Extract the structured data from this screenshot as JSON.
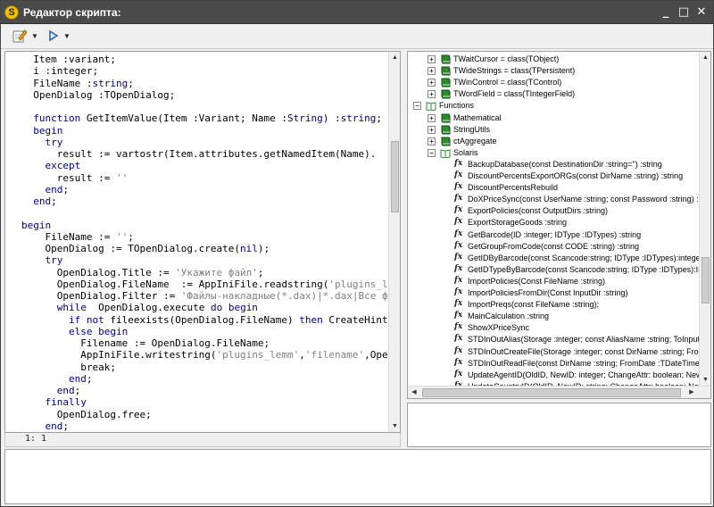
{
  "window": {
    "title": "Редактор скрипта:",
    "app_icon_letter": "S"
  },
  "titlebar_buttons": {
    "minimize": "_",
    "maximize": "□",
    "close": "✕"
  },
  "toolbar": {
    "edit_icon": "edit-icon",
    "run_icon": "run-icon"
  },
  "status": {
    "position": "1: 1"
  },
  "code": [
    [
      {
        "t": "  Item :variant;"
      }
    ],
    [
      {
        "t": "  i :integer;"
      }
    ],
    [
      {
        "t": "  FileName :"
      },
      {
        "t": "string",
        "c": "kw"
      },
      {
        "t": ";"
      }
    ],
    [
      {
        "t": "  OpenDialog :TOpenDialog;"
      }
    ],
    [
      {
        "t": ""
      }
    ],
    [
      {
        "t": "  "
      },
      {
        "t": "function",
        "c": "kw"
      },
      {
        "t": " GetItemValue(Item :Variant; Name :"
      },
      {
        "t": "String",
        "c": "kw"
      },
      {
        "t": ") :"
      },
      {
        "t": "string",
        "c": "kw"
      },
      {
        "t": ";"
      }
    ],
    [
      {
        "t": "  "
      },
      {
        "t": "begin",
        "c": "kw"
      }
    ],
    [
      {
        "t": "    "
      },
      {
        "t": "try",
        "c": "kw"
      }
    ],
    [
      {
        "t": "      result := vartostr(Item.attributes.getNamedItem(Name)."
      }
    ],
    [
      {
        "t": "    "
      },
      {
        "t": "except",
        "c": "kw"
      }
    ],
    [
      {
        "t": "      result := "
      },
      {
        "t": "''",
        "c": "str"
      }
    ],
    [
      {
        "t": "    "
      },
      {
        "t": "end",
        "c": "kw"
      },
      {
        "t": ";"
      }
    ],
    [
      {
        "t": "  "
      },
      {
        "t": "end",
        "c": "kw"
      },
      {
        "t": ";"
      }
    ],
    [
      {
        "t": ""
      }
    ],
    [
      {
        "t": "begin",
        "c": "kw"
      }
    ],
    [
      {
        "t": "    FileName := "
      },
      {
        "t": "''",
        "c": "str"
      },
      {
        "t": ";"
      }
    ],
    [
      {
        "t": "    OpenDialog := TOpenDialog.create("
      },
      {
        "t": "nil",
        "c": "kw"
      },
      {
        "t": ");"
      }
    ],
    [
      {
        "t": "    "
      },
      {
        "t": "try",
        "c": "kw"
      }
    ],
    [
      {
        "t": "      OpenDialog.Title := "
      },
      {
        "t": "'Укажите файл'",
        "c": "str"
      },
      {
        "t": ";"
      }
    ],
    [
      {
        "t": "      OpenDialog.FileName  := AppIniFile.readstring("
      },
      {
        "t": "'plugins_l",
        "c": "str"
      }
    ],
    [
      {
        "t": "      OpenDialog.Filter := "
      },
      {
        "t": "'Файлы-накладные(*.dax)|*.dax|Все ф",
        "c": "str"
      }
    ],
    [
      {
        "t": "      "
      },
      {
        "t": "while",
        "c": "kw"
      },
      {
        "t": "  OpenDialog.execute "
      },
      {
        "t": "do begin",
        "c": "kw"
      }
    ],
    [
      {
        "t": "        "
      },
      {
        "t": "if not",
        "c": "kw"
      },
      {
        "t": " fileexists(OpenDialog.FileName) "
      },
      {
        "t": "then",
        "c": "kw"
      },
      {
        "t": " CreateHint"
      }
    ],
    [
      {
        "t": "        "
      },
      {
        "t": "else begin",
        "c": "kw"
      }
    ],
    [
      {
        "t": "          Filename := OpenDialog.FileName;"
      }
    ],
    [
      {
        "t": "          AppIniFile.writestring("
      },
      {
        "t": "'plugins_lemm'",
        "c": "str"
      },
      {
        "t": ","
      },
      {
        "t": "'filename'",
        "c": "str"
      },
      {
        "t": ",Ope"
      }
    ],
    [
      {
        "t": "          break;"
      }
    ],
    [
      {
        "t": "        "
      },
      {
        "t": "end",
        "c": "kw"
      },
      {
        "t": ";"
      }
    ],
    [
      {
        "t": "      "
      },
      {
        "t": "end",
        "c": "kw"
      },
      {
        "t": ";"
      }
    ],
    [
      {
        "t": "    "
      },
      {
        "t": "finally",
        "c": "kw"
      }
    ],
    [
      {
        "t": "      OpenDialog.free;"
      }
    ],
    [
      {
        "t": "    "
      },
      {
        "t": "end",
        "c": "kw"
      },
      {
        "t": ";"
      }
    ]
  ],
  "tree": [
    {
      "level": 2,
      "kind": "class",
      "expander": "+",
      "label": "TWaitCursor = class(TObject)"
    },
    {
      "level": 2,
      "kind": "class",
      "expander": "+",
      "label": "TWideStrings = class(TPersistent)"
    },
    {
      "level": 2,
      "kind": "class",
      "expander": "+",
      "label": "TWinControl = class(TControl)"
    },
    {
      "level": 2,
      "kind": "class",
      "expander": "+",
      "label": "TWordField = class(TIntegerField)"
    },
    {
      "level": 1,
      "kind": "folder",
      "expander": "−",
      "label": "Functions"
    },
    {
      "level": 2,
      "kind": "class",
      "expander": "+",
      "label": "Mathematical"
    },
    {
      "level": 2,
      "kind": "class",
      "expander": "+",
      "label": "StringUtils"
    },
    {
      "level": 2,
      "kind": "class",
      "expander": "+",
      "label": "ctAggregate"
    },
    {
      "level": 2,
      "kind": "folder",
      "expander": "−",
      "label": "Solaris"
    },
    {
      "level": 3,
      "kind": "func",
      "label": "BackupDatabase(const DestinationDir :string='') :string"
    },
    {
      "level": 3,
      "kind": "func",
      "label": "DiscountPercentsExportORGs(const DirName :string) :string"
    },
    {
      "level": 3,
      "kind": "func",
      "label": "DiscountPercentsRebuild"
    },
    {
      "level": 3,
      "kind": "func",
      "label": "DoXPriceSync(const UserName :string; const Password :string) :st"
    },
    {
      "level": 3,
      "kind": "func",
      "label": "ExportPolicies(const OutputDirs :string)"
    },
    {
      "level": 3,
      "kind": "func",
      "label": "ExportStorageGoods :string"
    },
    {
      "level": 3,
      "kind": "func",
      "label": "GetBarcode(ID :integer; IDType :IDTypes) :string"
    },
    {
      "level": 3,
      "kind": "func",
      "label": "GetGroupFromCode(const CODE :string) :string"
    },
    {
      "level": 3,
      "kind": "func",
      "label": "GetIDByBarcode(const Scancode:string; IDType :IDTypes):intege"
    },
    {
      "level": 3,
      "kind": "func",
      "label": "GetIDTypeByBarcode(const Scancode:string; IDType :IDTypes):ID"
    },
    {
      "level": 3,
      "kind": "func",
      "label": "ImportPolicies(Const FileName :string)"
    },
    {
      "level": 3,
      "kind": "func",
      "label": "ImportPoliciesFromDir(Const InputDir :string)"
    },
    {
      "level": 3,
      "kind": "func",
      "label": "ImportPreqs(const FileName :string);"
    },
    {
      "level": 3,
      "kind": "func",
      "label": "MainCalculation :string"
    },
    {
      "level": 3,
      "kind": "func",
      "label": "ShowXPriceSync"
    },
    {
      "level": 3,
      "kind": "func",
      "label": "STDInOutAlias(Storage :integer; const AliasName :string; ToInput"
    },
    {
      "level": 3,
      "kind": "func",
      "label": "STDInOutCreateFile(Storage :integer; const DirName :string; Fron"
    },
    {
      "level": 3,
      "kind": "func",
      "label": "STDInOutReadFile(const DirName :string; FromDate :TDateTime; T"
    },
    {
      "level": 3,
      "kind": "func",
      "label": "UpdateAgentID(OldID, NewID: integer; ChangeAttr: boolean; New"
    },
    {
      "level": 3,
      "kind": "func",
      "label": "UpdateCountryID(OldID, NewID: string; ChangeAttr: boolean; New"
    }
  ],
  "colors": {
    "titlebar": "#4a4a4a",
    "keyword": "#00008b",
    "string": "#808080",
    "book_green": "#2e8b2e"
  }
}
